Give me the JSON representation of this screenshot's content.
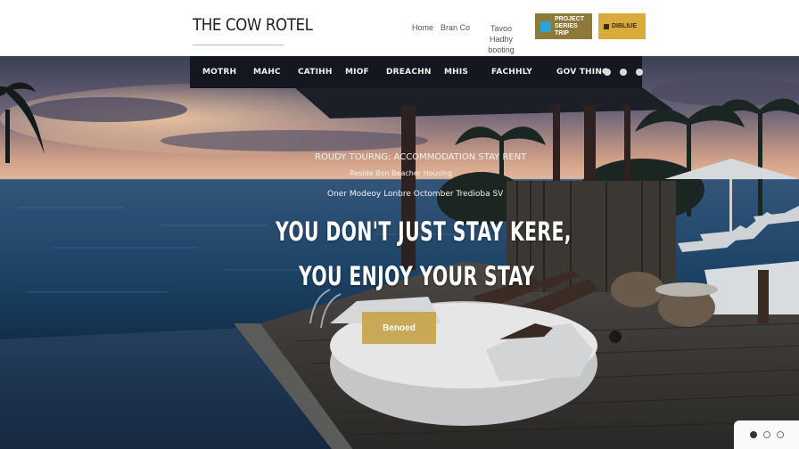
{
  "header": {
    "logo": "THE COW ROTEL",
    "links": [
      "Home",
      "Bran Co"
    ],
    "link_stack": [
      "Tavoo Hadhy",
      "booting"
    ],
    "badges": [
      {
        "label": "PROJECT SERIES TRIP",
        "color": "#8d7a3b"
      },
      {
        "label": "DIBLIUE",
        "color": "#d8ab3a"
      }
    ]
  },
  "nav": {
    "items": [
      "MOTRH",
      "MAHC",
      "CATIHH",
      "MIOF",
      "DREACHN",
      "MHIS",
      "FACHHLY",
      "GOV THING"
    ],
    "social_icons": [
      "instagram-icon",
      "twitter-icon",
      "pinterest-icon"
    ]
  },
  "hero": {
    "subtitle_1": "ROUDY TOURNG: ACCOMMODATION STAY RENT",
    "subtitle_2": "Reside Bon Beacher Housing",
    "subtitle_3": "Oner Modeoy Lonbre Octomber Tredioba SV",
    "headline_1": "YOU DON'T JUST STAY KERE,",
    "headline_2": "YOU ENJOY YOUR STAY",
    "cta_label": "Benoed"
  },
  "slider": {
    "count": 3,
    "active_index": 0
  },
  "colors": {
    "nav_bg": "#14171f",
    "cta": "#c9a958",
    "badge_1": "#8d7a3b",
    "badge_2": "#d8ab3a"
  }
}
